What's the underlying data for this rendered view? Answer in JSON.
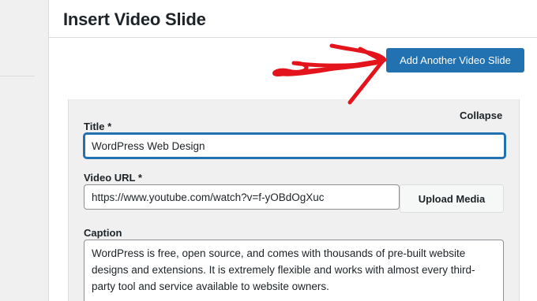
{
  "header": {
    "title": "Insert Video Slide"
  },
  "toolbar": {
    "add_button_label": "Add Another Video Slide"
  },
  "slide": {
    "collapse_label": "Collapse",
    "title_label": "Title *",
    "title_value": "WordPress Web Design",
    "video_url_label": "Video URL *",
    "video_url_value": "https://www.youtube.com/watch?v=f-yOBdOgXuc",
    "upload_button_label": "Upload Media",
    "caption_label": "Caption",
    "caption_value": "WordPress is free, open source, and comes with thousands of pre-built website designs and extensions. It is extremely flexible and works with almost every third-party tool and service available to website owners."
  },
  "annotation": {
    "arrow_color": "#e3141b"
  },
  "colors": {
    "primary_button": "#2271b1",
    "focus_border": "#2271b1",
    "panel_bg": "#ffffff",
    "form_bg": "#f0f0f1"
  }
}
